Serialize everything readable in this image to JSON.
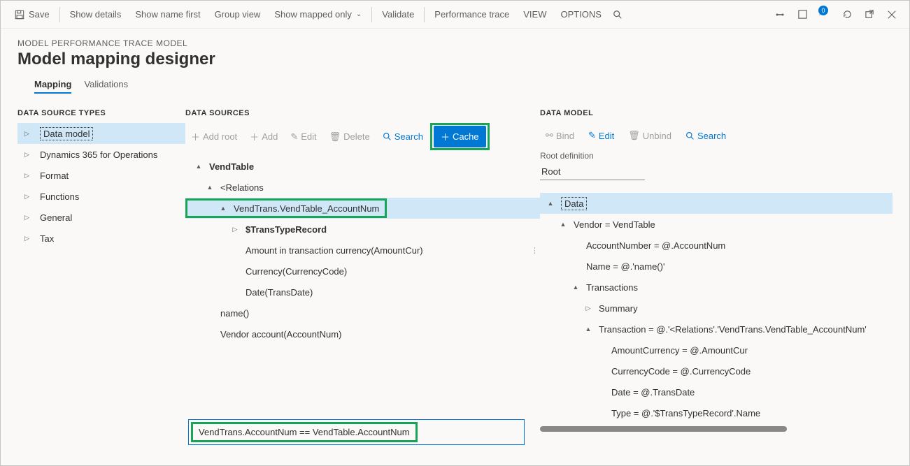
{
  "toolbar": {
    "save": "Save",
    "show_details": "Show details",
    "show_name_first": "Show name first",
    "group_view": "Group view",
    "show_mapped_only": "Show mapped only",
    "validate": "Validate",
    "performance_trace": "Performance trace",
    "view": "VIEW",
    "options": "OPTIONS",
    "attach_badge": "0"
  },
  "header": {
    "breadcrumb": "MODEL PERFORMANCE TRACE MODEL",
    "title": "Model mapping designer",
    "tabs": {
      "mapping": "Mapping",
      "validations": "Validations"
    }
  },
  "types": {
    "title": "DATA SOURCE TYPES",
    "items": [
      "Data model",
      "Dynamics 365 for Operations",
      "Format",
      "Functions",
      "General",
      "Tax"
    ]
  },
  "sources": {
    "title": "DATA SOURCES",
    "actions": {
      "add_root": "Add root",
      "add": "Add",
      "edit": "Edit",
      "delete": "Delete",
      "search": "Search",
      "cache": "Cache"
    },
    "tree": {
      "n0": "VendTable",
      "n1": "<Relations",
      "n2": "VendTrans.VendTable_AccountNum",
      "n3": "$TransTypeRecord",
      "n4": "Amount in transaction currency(AmountCur)",
      "n5": "Currency(CurrencyCode)",
      "n6": "Date(TransDate)",
      "n7": "name()",
      "n8": "Vendor account(AccountNum)"
    },
    "expression": "VendTrans.AccountNum == VendTable.AccountNum"
  },
  "model": {
    "title": "DATA MODEL",
    "actions": {
      "bind": "Bind",
      "edit": "Edit",
      "unbind": "Unbind",
      "search": "Search"
    },
    "root_label": "Root definition",
    "root_value": "Root",
    "tree": {
      "n0": "Data",
      "n1": "Vendor = VendTable",
      "n2": "AccountNumber = @.AccountNum",
      "n3": "Name = @.'name()'",
      "n4": "Transactions",
      "n5": "Summary",
      "n6": "Transaction = @.'<Relations'.'VendTrans.VendTable_AccountNum'",
      "n7": "AmountCurrency = @.AmountCur",
      "n8": "CurrencyCode = @.CurrencyCode",
      "n9": "Date = @.TransDate",
      "n10": "Type = @.'$TransTypeRecord'.Name"
    }
  }
}
